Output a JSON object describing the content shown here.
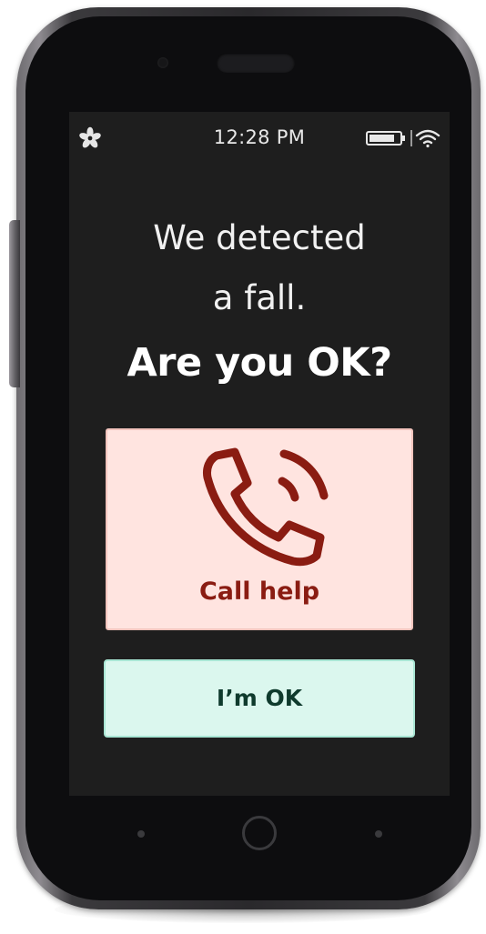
{
  "device": {
    "nav": {
      "left_icon": "back-dot-icon",
      "home_icon": "home-ring-icon",
      "right_icon": "menu-dot-icon"
    }
  },
  "status_bar": {
    "app_icon": "flower-icon",
    "time": "12:28 PM",
    "battery_icon": "battery-icon",
    "wifi_icon": "wifi-icon"
  },
  "alert": {
    "headline_line1": "We detected",
    "headline_line2": "a fall.",
    "question": "Are you OK?"
  },
  "actions": {
    "call_help": {
      "icon": "phone-calling-icon",
      "label": "Call help"
    },
    "im_ok": {
      "label": "I’m OK"
    }
  },
  "colors": {
    "screen_bg": "#1e1e1e",
    "call_bg": "#ffe4e0",
    "call_fg": "#8a1c12",
    "ok_bg": "#dbf7ee",
    "ok_fg": "#0f3b2d"
  }
}
